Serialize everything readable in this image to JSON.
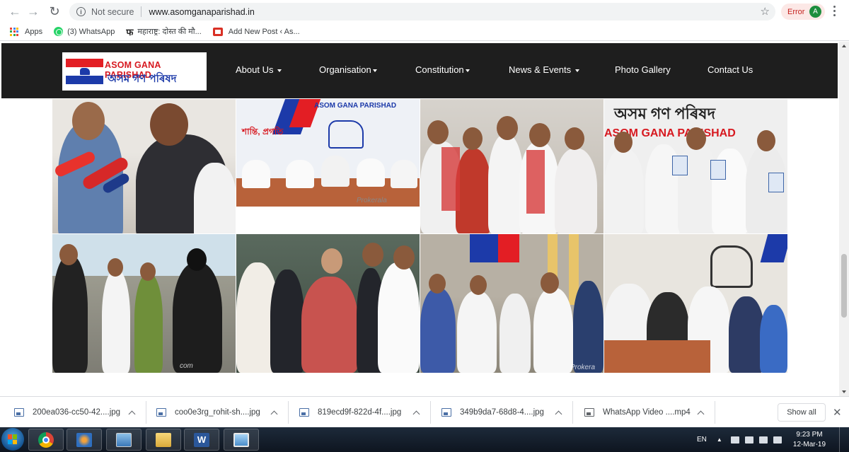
{
  "browser": {
    "security_label": "Not secure",
    "url": "www.asomganaparishad.in",
    "error_label": "Error",
    "profile_initial": "A",
    "bookmarks": [
      {
        "label": "Apps",
        "icon": "apps-grid-icon"
      },
      {
        "label": "(3) WhatsApp",
        "icon": "whatsapp-icon"
      },
      {
        "label": "महाराष्ट्र: दोस्त की मौ...",
        "icon": "fa-logo-icon"
      },
      {
        "label": "Add New Post ‹ As...",
        "icon": "post-icon"
      }
    ]
  },
  "site": {
    "logo": {
      "english": "ASOM GANA PARISHAD",
      "assamese": "অসম গণ পৰিষদ"
    },
    "nav": [
      {
        "label": "About Us",
        "dropdown": true
      },
      {
        "label": "Organisation",
        "dropdown": true
      },
      {
        "label": "Constitution",
        "dropdown": true
      },
      {
        "label": "News & Events",
        "dropdown": true
      },
      {
        "label": "Photo Gallery",
        "dropdown": false
      },
      {
        "label": "Contact Us",
        "dropdown": false
      }
    ],
    "gallery": {
      "photos": [
        {
          "caption": ""
        },
        {
          "caption": "Prokerala",
          "signage": [
            "ASOM GANA PARISHAD",
            "শান্তি, প্ৰগতি"
          ]
        },
        {
          "caption": ""
        },
        {
          "caption": "",
          "signage": [
            "অসম গণ পৰিষদ",
            "ASOM GANA PARISHAD"
          ]
        },
        {
          "caption": "com"
        },
        {
          "caption": ""
        },
        {
          "caption": "Prokera"
        },
        {
          "caption": ""
        }
      ]
    }
  },
  "downloads": {
    "items": [
      {
        "name": "200ea036-cc50-42....jpg",
        "type": "image"
      },
      {
        "name": "coo0e3rg_rohit-sh....jpg",
        "type": "image"
      },
      {
        "name": "819ecd9f-822d-4f....jpg",
        "type": "image"
      },
      {
        "name": "349b9da7-68d8-4....jpg",
        "type": "image"
      },
      {
        "name": "WhatsApp Video ....mp4",
        "type": "video"
      }
    ],
    "show_all_label": "Show all"
  },
  "taskbar": {
    "language": "EN",
    "time": "9:23 PM",
    "date": "12-Mar-19"
  },
  "colors": {
    "header_bg": "#1e1e1e",
    "logo_red": "#d71920",
    "logo_blue": "#1c3aa9",
    "error_text": "#c5221f"
  }
}
